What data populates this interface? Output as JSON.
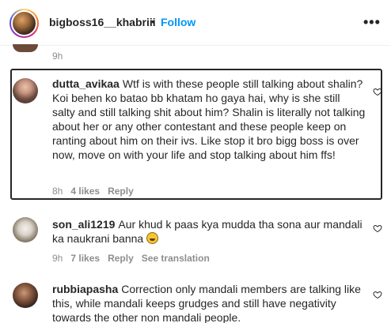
{
  "header": {
    "username": "bigboss16__khabriii",
    "separator": "•",
    "follow_label": "Follow",
    "more_icon": "more-options-icon"
  },
  "previous_comment": {
    "time": "9h"
  },
  "comments": [
    {
      "username": "dutta_avikaa",
      "text": "Wtf is with these people still talking about shalin? Koi behen ko batao bb khatam ho gaya hai, why is she still salty and still talking shit about him? Shalin is literally not talking about her or any other contestant and these people keep on ranting about him on their ivs. Like stop it bro bigg boss is over now, move on with your life and stop talking about him ffs!",
      "time": "8h",
      "likes": "4 likes",
      "reply_label": "Reply",
      "highlighted": true
    },
    {
      "username": "son_ali1219",
      "text": "Aur khud k paas kya mudda tha sona aur mandali ka naukrani banna",
      "emoji": "grinning-face-emoji",
      "time": "9h",
      "likes": "7 likes",
      "reply_label": "Reply",
      "translation_label": "See translation"
    },
    {
      "username": "rubbiapasha",
      "text": "Correction only mandali members are talking like this, while mandali keeps grudges and still have negativity towards the other non mandali people."
    }
  ]
}
